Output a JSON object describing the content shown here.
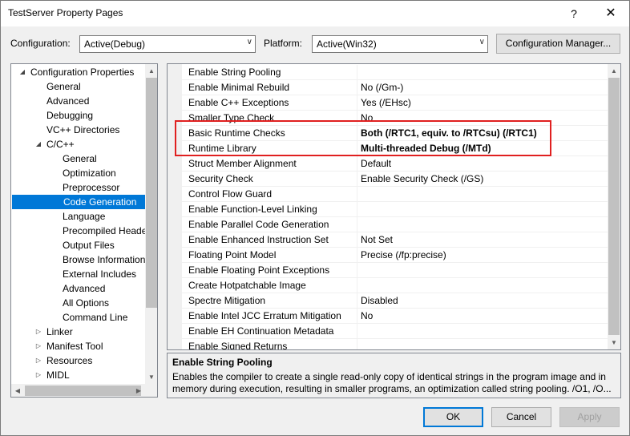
{
  "window": {
    "title": "TestServer Property Pages",
    "help_glyph": "?",
    "close_glyph": "✕"
  },
  "toolbar": {
    "configuration_label": "Configuration:",
    "configuration_value": "Active(Debug)",
    "platform_label": "Platform:",
    "platform_value": "Active(Win32)",
    "config_manager_label": "Configuration Manager..."
  },
  "tree": {
    "items": [
      {
        "label": "Configuration Properties",
        "expander": "◢"
      },
      {
        "label": "General",
        "expander": ""
      },
      {
        "label": "Advanced",
        "expander": ""
      },
      {
        "label": "Debugging",
        "expander": ""
      },
      {
        "label": "VC++ Directories",
        "expander": ""
      },
      {
        "label": "C/C++",
        "expander": "◢"
      },
      {
        "label": "General",
        "expander": ""
      },
      {
        "label": "Optimization",
        "expander": ""
      },
      {
        "label": "Preprocessor",
        "expander": ""
      },
      {
        "label": "Code Generation",
        "expander": ""
      },
      {
        "label": "Language",
        "expander": ""
      },
      {
        "label": "Precompiled Heade",
        "expander": ""
      },
      {
        "label": "Output Files",
        "expander": ""
      },
      {
        "label": "Browse Information",
        "expander": ""
      },
      {
        "label": "External Includes",
        "expander": ""
      },
      {
        "label": "Advanced",
        "expander": ""
      },
      {
        "label": "All Options",
        "expander": ""
      },
      {
        "label": "Command Line",
        "expander": ""
      },
      {
        "label": "Linker",
        "expander": "▷"
      },
      {
        "label": "Manifest Tool",
        "expander": "▷"
      },
      {
        "label": "Resources",
        "expander": "▷"
      },
      {
        "label": "MIDL",
        "expander": "▷"
      }
    ],
    "selected": "Code Generation"
  },
  "grid": {
    "rows": [
      {
        "name": "Enable String Pooling",
        "value": "",
        "bold": false
      },
      {
        "name": "Enable Minimal Rebuild",
        "value": "No (/Gm-)",
        "bold": false
      },
      {
        "name": "Enable C++ Exceptions",
        "value": "Yes (/EHsc)",
        "bold": false
      },
      {
        "name": "Smaller Type Check",
        "value": "No",
        "bold": false
      },
      {
        "name": "Basic Runtime Checks",
        "value": "Both (/RTC1, equiv. to /RTCsu) (/RTC1)",
        "bold": true
      },
      {
        "name": "Runtime Library",
        "value": "Multi-threaded Debug (/MTd)",
        "bold": true
      },
      {
        "name": "Struct Member Alignment",
        "value": "Default",
        "bold": false
      },
      {
        "name": "Security Check",
        "value": "Enable Security Check (/GS)",
        "bold": false
      },
      {
        "name": "Control Flow Guard",
        "value": "",
        "bold": false
      },
      {
        "name": "Enable Function-Level Linking",
        "value": "",
        "bold": false
      },
      {
        "name": "Enable Parallel Code Generation",
        "value": "",
        "bold": false
      },
      {
        "name": "Enable Enhanced Instruction Set",
        "value": "Not Set",
        "bold": false
      },
      {
        "name": "Floating Point Model",
        "value": "Precise (/fp:precise)",
        "bold": false
      },
      {
        "name": "Enable Floating Point Exceptions",
        "value": "",
        "bold": false
      },
      {
        "name": "Create Hotpatchable Image",
        "value": "",
        "bold": false
      },
      {
        "name": "Spectre Mitigation",
        "value": "Disabled",
        "bold": false
      },
      {
        "name": "Enable Intel JCC Erratum Mitigation",
        "value": "No",
        "bold": false
      },
      {
        "name": "Enable EH Continuation Metadata",
        "value": "",
        "bold": false
      },
      {
        "name": "Enable Signed Returns",
        "value": "",
        "bold": false
      }
    ]
  },
  "description": {
    "title": "Enable String Pooling",
    "text": "Enables the compiler to create a single read-only copy of identical strings in the program image and in memory during execution, resulting in smaller programs, an optimization called string pooling. /O1, /O..."
  },
  "buttons": {
    "ok": "OK",
    "cancel": "Cancel",
    "apply": "Apply"
  },
  "colors": {
    "selection": "#0078d7",
    "highlight_box": "#e02020"
  }
}
